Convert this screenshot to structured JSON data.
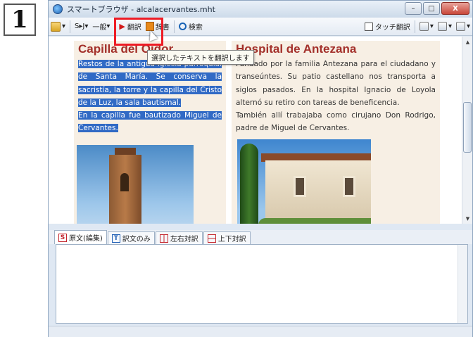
{
  "step_badge": "1",
  "window": {
    "title": "スマートブラウザ - alcalacervantes.mht",
    "controls": {
      "minimize": "–",
      "maximize": "□",
      "close": "X"
    }
  },
  "toolbar": {
    "items": [
      {
        "name": "sj",
        "label": "S▸J▾"
      },
      {
        "name": "general",
        "label": "一般"
      },
      {
        "name": "translate",
        "label": "翻訳"
      },
      {
        "name": "dictionary",
        "label": "辞書"
      },
      {
        "name": "search",
        "label": "検索"
      },
      {
        "name": "touch-translate",
        "label": "タッチ翻訳"
      }
    ],
    "tooltip": "選択したテキストを翻訳します"
  },
  "page": {
    "left": {
      "title": "Capilla del Oidor",
      "selected_paragraphs": [
        "Restos de la antigua iglesia parroquial de Santa María. Se conserva la sacristía, la torre y la capilla del Cristo de la Luz, la sala bautismal.",
        "En la capilla fue bautizado Miguel de Cervantes."
      ]
    },
    "right": {
      "title": "Hospital de Antezana",
      "paragraphs": [
        "Fundado por la familia Antezana para el ciudadano y transeúntes. Su patio castellano nos transporta a siglos pasados. En la hospital Ignacio de Loyola alternó su retiro con tareas de beneficencia.",
        "También allí trabajaba como cirujano Don Rodrigo, padre de Miguel de Cervantes."
      ]
    }
  },
  "tabs": [
    {
      "icon": "S",
      "label": "原文(編集)",
      "kind": "s",
      "active": true
    },
    {
      "icon": "T",
      "label": "訳文のみ",
      "kind": "t",
      "active": false
    },
    {
      "icon": "",
      "label": "左右対訳",
      "kind": "lr",
      "active": false
    },
    {
      "icon": "",
      "label": "上下対訳",
      "kind": "tb",
      "active": false
    }
  ],
  "colors": {
    "accent_red": "#ee1c25",
    "title_red": "#a3302a",
    "selection": "#316ac5"
  }
}
